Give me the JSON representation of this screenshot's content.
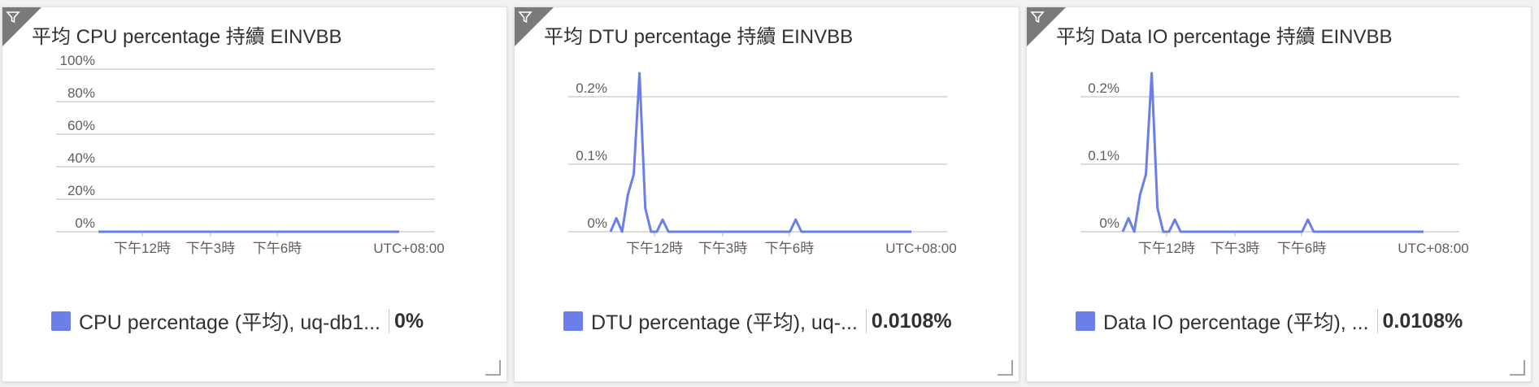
{
  "colors": {
    "series": "#6b7fe8",
    "grid": "#c8c8c8",
    "text": "#323130"
  },
  "icons": {
    "filter": "filter-icon",
    "resize": "resize-handle-icon"
  },
  "tiles": [
    {
      "title": "平均 CPU percentage 持續 EINVBB",
      "legend_label": "CPU percentage (平均), uq-db1...",
      "legend_value": "0%"
    },
    {
      "title": "平均 DTU percentage 持續 EINVBB",
      "legend_label": "DTU percentage (平均), uq-...",
      "legend_value": "0.0108%"
    },
    {
      "title": "平均 Data IO percentage 持續 EINVBB",
      "legend_label": "Data IO percentage (平均), ...",
      "legend_value": "0.0108%"
    }
  ],
  "chart_data": [
    {
      "type": "line",
      "title": "平均 CPU percentage 持續 EINVBB",
      "x_tick_labels": [
        "下午12時",
        "下午3時",
        "下午6時"
      ],
      "timezone_label": "UTC+08:00",
      "y_ticks": [
        0,
        20,
        40,
        60,
        80,
        100
      ],
      "y_tick_labels": [
        "0%",
        "20%",
        "40%",
        "60%",
        "80%",
        "100%"
      ],
      "ylim": [
        0,
        100
      ],
      "grid": true,
      "legend_placement": "bottom",
      "series": [
        {
          "name": "CPU percentage (平均), uq-db1...",
          "x": [
            0,
            1,
            2,
            3,
            4,
            5,
            6,
            7,
            8,
            9,
            10,
            11,
            12,
            13,
            14,
            15,
            16,
            17,
            18,
            19,
            20,
            21,
            22,
            23,
            24,
            25,
            26,
            27,
            28,
            29,
            30,
            31,
            32,
            33,
            34,
            35,
            36,
            37,
            38,
            39,
            40,
            41,
            42,
            43,
            44,
            45,
            46,
            47,
            48,
            49,
            50,
            51,
            52
          ],
          "values": [
            0,
            0,
            0,
            0,
            0,
            0,
            0,
            0,
            0,
            0,
            0,
            0,
            0,
            0,
            0,
            0,
            0,
            0,
            0,
            0,
            0,
            0,
            0,
            0,
            0,
            0,
            0,
            0,
            0,
            0,
            0,
            0,
            0,
            0,
            0,
            0,
            0,
            0,
            0,
            0,
            0,
            0,
            0,
            0,
            0,
            0,
            0,
            0,
            0,
            0,
            0,
            0,
            0
          ]
        }
      ]
    },
    {
      "type": "line",
      "title": "平均 DTU percentage 持續 EINVBB",
      "x_tick_labels": [
        "下午12時",
        "下午3時",
        "下午6時"
      ],
      "timezone_label": "UTC+08:00",
      "y_ticks": [
        0,
        0.1,
        0.2
      ],
      "y_tick_labels": [
        "0%",
        "0.1%",
        "0.2%"
      ],
      "ylim": [
        0,
        0.2
      ],
      "grid": true,
      "legend_placement": "bottom",
      "series": [
        {
          "name": "DTU percentage (平均), uq-...",
          "x": [
            0,
            1,
            2,
            3,
            4,
            5,
            6,
            7,
            8,
            9,
            10,
            11,
            12,
            13,
            14,
            15,
            16,
            17,
            18,
            19,
            20,
            21,
            22,
            23,
            24,
            25,
            26,
            27,
            28,
            29,
            30,
            31,
            32,
            33,
            34,
            35,
            36,
            37,
            38,
            39,
            40,
            41,
            42,
            43,
            44,
            45,
            46,
            47,
            48,
            49,
            50,
            51,
            52
          ],
          "values": [
            0,
            0.02,
            0,
            0.055,
            0.085,
            0.235,
            0.035,
            0,
            0,
            0.018,
            0,
            0,
            0,
            0,
            0,
            0,
            0,
            0,
            0,
            0,
            0,
            0,
            0,
            0,
            0,
            0,
            0,
            0,
            0,
            0,
            0,
            0,
            0.018,
            0,
            0,
            0,
            0,
            0,
            0,
            0,
            0,
            0,
            0,
            0,
            0,
            0,
            0,
            0,
            0,
            0,
            0,
            0,
            0
          ]
        }
      ]
    },
    {
      "type": "line",
      "title": "平均 Data IO percentage 持續 EINVBB",
      "x_tick_labels": [
        "下午12時",
        "下午3時",
        "下午6時"
      ],
      "timezone_label": "UTC+08:00",
      "y_ticks": [
        0,
        0.1,
        0.2
      ],
      "y_tick_labels": [
        "0%",
        "0.1%",
        "0.2%"
      ],
      "ylim": [
        0,
        0.2
      ],
      "grid": true,
      "legend_placement": "bottom",
      "series": [
        {
          "name": "Data IO percentage (平均), ...",
          "x": [
            0,
            1,
            2,
            3,
            4,
            5,
            6,
            7,
            8,
            9,
            10,
            11,
            12,
            13,
            14,
            15,
            16,
            17,
            18,
            19,
            20,
            21,
            22,
            23,
            24,
            25,
            26,
            27,
            28,
            29,
            30,
            31,
            32,
            33,
            34,
            35,
            36,
            37,
            38,
            39,
            40,
            41,
            42,
            43,
            44,
            45,
            46,
            47,
            48,
            49,
            50,
            51,
            52
          ],
          "values": [
            0,
            0.02,
            0,
            0.055,
            0.085,
            0.235,
            0.035,
            0,
            0,
            0.018,
            0,
            0,
            0,
            0,
            0,
            0,
            0,
            0,
            0,
            0,
            0,
            0,
            0,
            0,
            0,
            0,
            0,
            0,
            0,
            0,
            0,
            0,
            0.018,
            0,
            0,
            0,
            0,
            0,
            0,
            0,
            0,
            0,
            0,
            0,
            0,
            0,
            0,
            0,
            0,
            0,
            0,
            0,
            0
          ]
        }
      ]
    }
  ]
}
